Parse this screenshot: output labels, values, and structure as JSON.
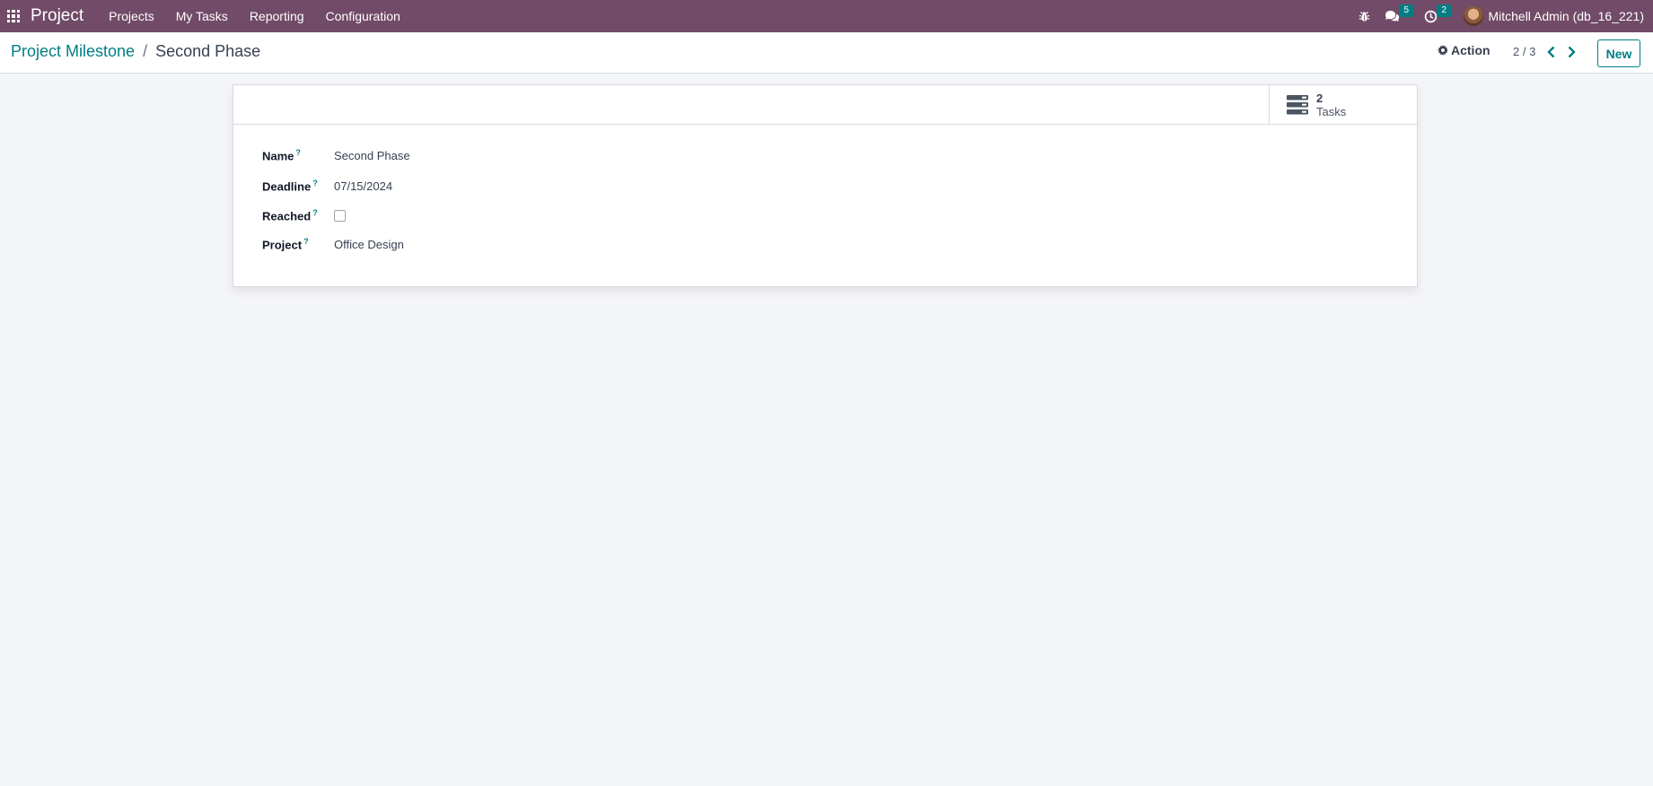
{
  "navbar": {
    "app_name": "Project",
    "menu": [
      "Projects",
      "My Tasks",
      "Reporting",
      "Configuration"
    ],
    "messages_count": "5",
    "activities_count": "2",
    "user": "Mitchell Admin (db_16_221)"
  },
  "control_panel": {
    "breadcrumb_parent": "Project Milestone",
    "breadcrumb_separator": "/",
    "breadcrumb_current": "Second Phase",
    "action_label": "Action",
    "pager": "2 / 3",
    "new_label": "New"
  },
  "smart_button": {
    "value": "2",
    "label": "Tasks"
  },
  "form": {
    "fields": [
      {
        "label": "Name",
        "value": "Second Phase"
      },
      {
        "label": "Deadline",
        "value": "07/15/2024"
      },
      {
        "label": "Reached",
        "checked": false
      },
      {
        "label": "Project",
        "value": "Office Design"
      }
    ]
  },
  "colors": {
    "navbar": "#714b67",
    "accent": "#017e84",
    "background": "#f4f5f8"
  },
  "icons": [
    "apps-grid-icon",
    "bug-icon",
    "chat-icon",
    "clock-icon",
    "gear-icon",
    "chevron-left-icon",
    "chevron-right-icon",
    "tasks-list-icon"
  ]
}
